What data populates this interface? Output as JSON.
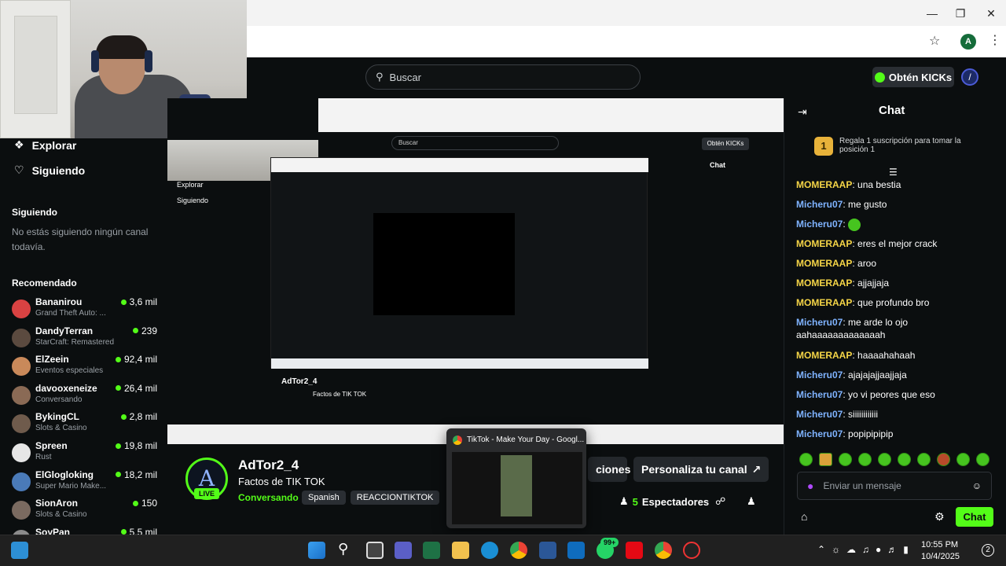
{
  "search": {
    "placeholder": "Buscar"
  },
  "header": {
    "kicks_label": "Obtén KICKs",
    "profile_initial": "A"
  },
  "sidebar": {
    "nav": [
      {
        "label": "Explorar"
      },
      {
        "label": "Siguiendo"
      }
    ],
    "following_heading": "Siguiendo",
    "following_empty": "No estás siguiendo ningún canal todavía.",
    "recommended_heading": "Recomendado",
    "recommended": [
      {
        "name": "Bananirou",
        "category": "Grand Theft Auto: ...",
        "viewers": "3,6 mil",
        "color": "#d94242"
      },
      {
        "name": "DandyTerran",
        "category": "StarCraft: Remastered",
        "viewers": "239",
        "color": "#5b4a3f"
      },
      {
        "name": "ElZeein",
        "category": "Eventos especiales",
        "viewers": "92,4 mil",
        "color": "#c9895a"
      },
      {
        "name": "davooxeneize",
        "category": "Conversando",
        "viewers": "26,4 mil",
        "color": "#8a6a55"
      },
      {
        "name": "BykingCL",
        "category": "Slots & Casino",
        "viewers": "2,8 mil",
        "color": "#6f5b4c"
      },
      {
        "name": "Spreen",
        "category": "Rust",
        "viewers": "19,8 mil",
        "color": "#e6e6e6"
      },
      {
        "name": "ElGlogloking",
        "category": "Super Mario Make...",
        "viewers": "18,2 mil",
        "color": "#4a7ab8"
      },
      {
        "name": "SionAron",
        "category": "Slots & Casino",
        "viewers": "150",
        "color": "#7a6a60"
      },
      {
        "name": "SoyPan",
        "category": "",
        "viewers": "5,5 mil",
        "color": "#8c8c8c"
      }
    ]
  },
  "stream": {
    "channel": "AdTor2_4",
    "title": "Factos de TIK TOK",
    "category": "Conversando",
    "tags": [
      "Spanish",
      "REACCIONTIKTOK"
    ],
    "live_label": "LIVE",
    "gift_button": "Regala Suscripciones",
    "partial_gift_button": "ciones",
    "customize_button": "Personaliza tu canal",
    "viewers_count": "5",
    "viewers_label": "Espectadores"
  },
  "chat": {
    "title": "Chat",
    "gift_rank": "1",
    "gift_prompt": "Regala 1 suscripción para tomar la posición 1",
    "messages": [
      {
        "user": "MOMERAAP",
        "text": "una bestia",
        "color": "#f5d547"
      },
      {
        "user": "Micheru07",
        "text": "me gusto",
        "color": "#7fb3ff"
      },
      {
        "user": "Micheru07",
        "text": "",
        "color": "#7fb3ff",
        "emote": true
      },
      {
        "user": "MOMERAAP",
        "text": "eres el mejor crack",
        "color": "#f5d547"
      },
      {
        "user": "MOMERAAP",
        "text": "aroo",
        "color": "#f5d547"
      },
      {
        "user": "MOMERAAP",
        "text": "ajjajjaja",
        "color": "#f5d547"
      },
      {
        "user": "MOMERAAP",
        "text": "que profundo bro",
        "color": "#f5d547"
      },
      {
        "user": "Micheru07",
        "text": "me arde lo ojo aahaaaaaaaaaaaaah",
        "color": "#7fb3ff"
      },
      {
        "user": "MOMERAAP",
        "text": "haaaahahaah",
        "color": "#f5d547"
      },
      {
        "user": "Micheru07",
        "text": "ajajajajjaajjaja",
        "color": "#7fb3ff"
      },
      {
        "user": "Micheru07",
        "text": "yo vi peores que eso",
        "color": "#7fb3ff"
      },
      {
        "user": "Micheru07",
        "text": "siiiiiiiiiiii",
        "color": "#7fb3ff"
      },
      {
        "user": "Micheru07",
        "text": "popipipipip",
        "color": "#7fb3ff"
      }
    ],
    "input_placeholder": "Enviar un mensaje",
    "send_label": "Chat"
  },
  "popup": {
    "title": "TikTok - Make Your Day - Googl..."
  },
  "taskbar": {
    "whatsapp_badge": "99+",
    "time": "10:55 PM",
    "date": "10/4/2025",
    "notification_count": "2"
  },
  "colors": {
    "accent": "#53fc18",
    "bg": "#0b0e0f"
  }
}
